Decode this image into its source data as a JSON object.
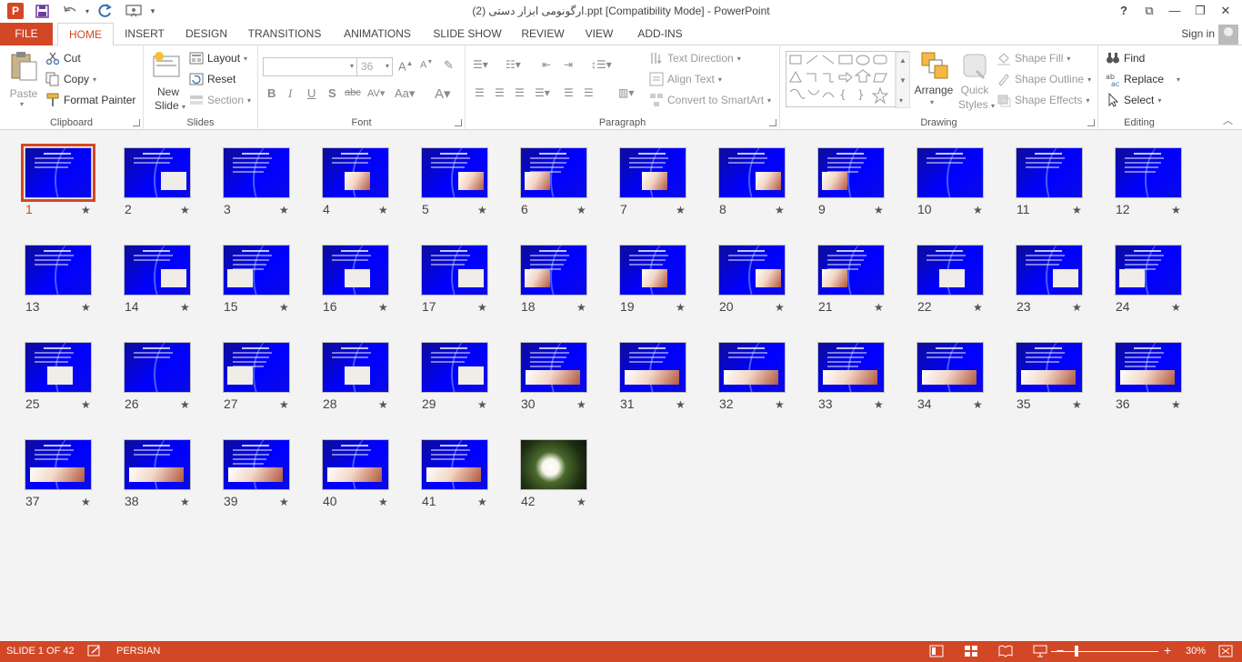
{
  "titlebar": {
    "app_icon": "P",
    "title": "ارگونومی ابزار دستی (2).ppt [Compatibility Mode] - PowerPoint",
    "qat_icons": [
      "save-icon",
      "undo-icon",
      "redo-icon",
      "from-beginning-icon",
      "customize-qat-icon"
    ],
    "help": "?",
    "restore_ribbon": "⧉",
    "minimize": "—",
    "maximize": "❐",
    "close": "✕"
  },
  "tabs": {
    "file": "FILE",
    "items": [
      "HOME",
      "INSERT",
      "DESIGN",
      "TRANSITIONS",
      "ANIMATIONS",
      "SLIDE SHOW",
      "REVIEW",
      "VIEW",
      "ADD-INS"
    ],
    "active": "HOME",
    "signin": "Sign in"
  },
  "ribbon": {
    "clipboard": {
      "label": "Clipboard",
      "paste": "Paste",
      "cut": "Cut",
      "copy": "Copy",
      "format_painter": "Format Painter"
    },
    "slides": {
      "label": "Slides",
      "new_slide_1": "New",
      "new_slide_2": "Slide",
      "layout": "Layout",
      "reset": "Reset",
      "section": "Section"
    },
    "font": {
      "label": "Font",
      "font_name": "",
      "font_size": "36"
    },
    "paragraph": {
      "label": "Paragraph",
      "text_direction": "Text Direction",
      "align_text": "Align Text",
      "convert_smartart": "Convert to SmartArt"
    },
    "drawing": {
      "label": "Drawing",
      "arrange": "Arrange",
      "quick_styles_1": "Quick",
      "quick_styles_2": "Styles",
      "shape_fill": "Shape Fill",
      "shape_outline": "Shape Outline",
      "shape_effects": "Shape Effects"
    },
    "editing": {
      "label": "Editing",
      "find": "Find",
      "replace": "Replace",
      "select": "Select"
    }
  },
  "sorter": {
    "selected": 1,
    "slides": [
      "1",
      "2",
      "3",
      "4",
      "5",
      "6",
      "7",
      "8",
      "9",
      "10",
      "11",
      "12",
      "13",
      "14",
      "15",
      "16",
      "17",
      "18",
      "19",
      "20",
      "21",
      "22",
      "23",
      "24",
      "25",
      "26",
      "27",
      "28",
      "29",
      "30",
      "31",
      "32",
      "33",
      "34",
      "35",
      "36",
      "37",
      "38",
      "39",
      "40",
      "41",
      "42"
    ],
    "star": "★"
  },
  "statusbar": {
    "slide_info": "SLIDE 1 OF 42",
    "language": "PERSIAN",
    "zoom": "30%",
    "zoom_out": "−",
    "zoom_in": "+"
  },
  "colors": {
    "accent": "#d24726",
    "slide_bg": "#0000ff"
  }
}
